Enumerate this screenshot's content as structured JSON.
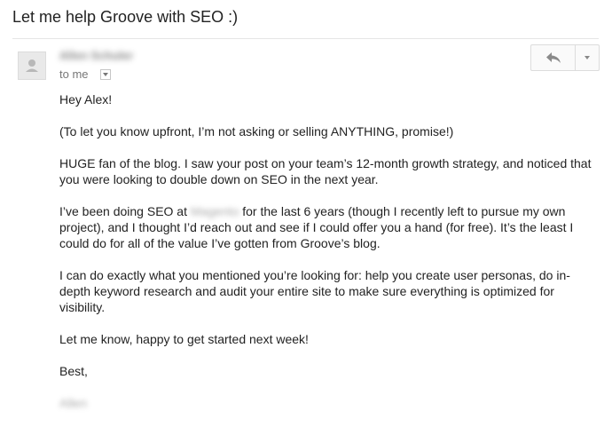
{
  "subject": "Let me help Groove with SEO :)",
  "sender": {
    "name": "Allen Schuler",
    "to_label": "to me"
  },
  "icons": {
    "avatar": "person-silhouette-icon",
    "reply": "reply-arrow-icon",
    "more": "chevron-down-icon",
    "recipients": "chevron-down-icon"
  },
  "colors": {
    "text": "#222222",
    "muted": "#777777",
    "border": "#dcdcdc"
  },
  "body": {
    "greeting": "Hey Alex!",
    "p1": "(To let you know upfront, I’m not asking or selling ANYTHING, promise!)",
    "p2": "HUGE fan of the blog. I saw your post on your team’s 12-month growth strategy, and noticed that you were looking to double down on SEO in the next year.",
    "p3_before": "I’ve been doing SEO at ",
    "p3_company": "Magento",
    "p3_after": " for the last 6 years (though I recently left to pursue my own project), and I thought I’d reach out and see if I could offer you a hand (for free). It’s the least I could do for all of the value I’ve gotten from Groove’s blog.",
    "p4": "I can do exactly what you mentioned you’re looking for: help you create user personas, do in-depth keyword research and audit your entire site to make sure everything is optimized for visibility.",
    "p5": "Let me know, happy to get started next week!",
    "signoff": "Best,",
    "signature": "Allen"
  }
}
